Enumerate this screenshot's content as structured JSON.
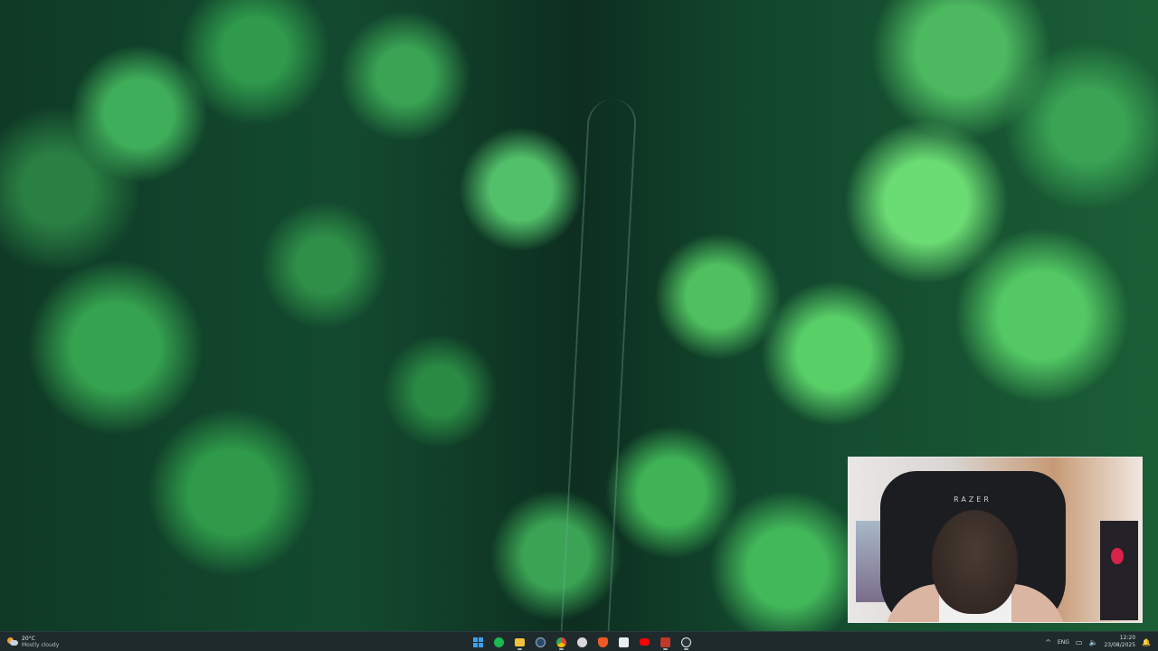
{
  "taskbar": {
    "weather": {
      "temperature": "20°C",
      "condition": "Mostly cloudy",
      "icon": "partly-cloudy-icon"
    },
    "apps": [
      {
        "name": "start",
        "icon": "windows-logo-icon",
        "color": "#3aa2ec"
      },
      {
        "name": "spotify",
        "icon": "spotify-icon",
        "color": "#1db954"
      },
      {
        "name": "file-explorer",
        "icon": "folder-icon",
        "color": "#f3c13a"
      },
      {
        "name": "steam",
        "icon": "steam-icon",
        "color": "#2a4a6b"
      },
      {
        "name": "chrome",
        "icon": "chrome-icon",
        "color": "#e94235"
      },
      {
        "name": "chatgpt",
        "icon": "chatgpt-icon",
        "color": "#d9d9d9"
      },
      {
        "name": "brave",
        "icon": "brave-icon",
        "color": "#f05a24"
      },
      {
        "name": "calendar",
        "icon": "calendar-icon",
        "color": "#e9eef2"
      },
      {
        "name": "youtube",
        "icon": "youtube-icon",
        "color": "#ff0000"
      },
      {
        "name": "recorder",
        "icon": "recorder-icon",
        "color": "#c0392b"
      },
      {
        "name": "media-player",
        "icon": "play-icon",
        "color": "#e9eef2"
      }
    ],
    "tray": {
      "language": "ENG",
      "time": "12:20",
      "date": "23/08/2025"
    }
  },
  "webcam": {
    "chair_brand": "RAZER"
  }
}
